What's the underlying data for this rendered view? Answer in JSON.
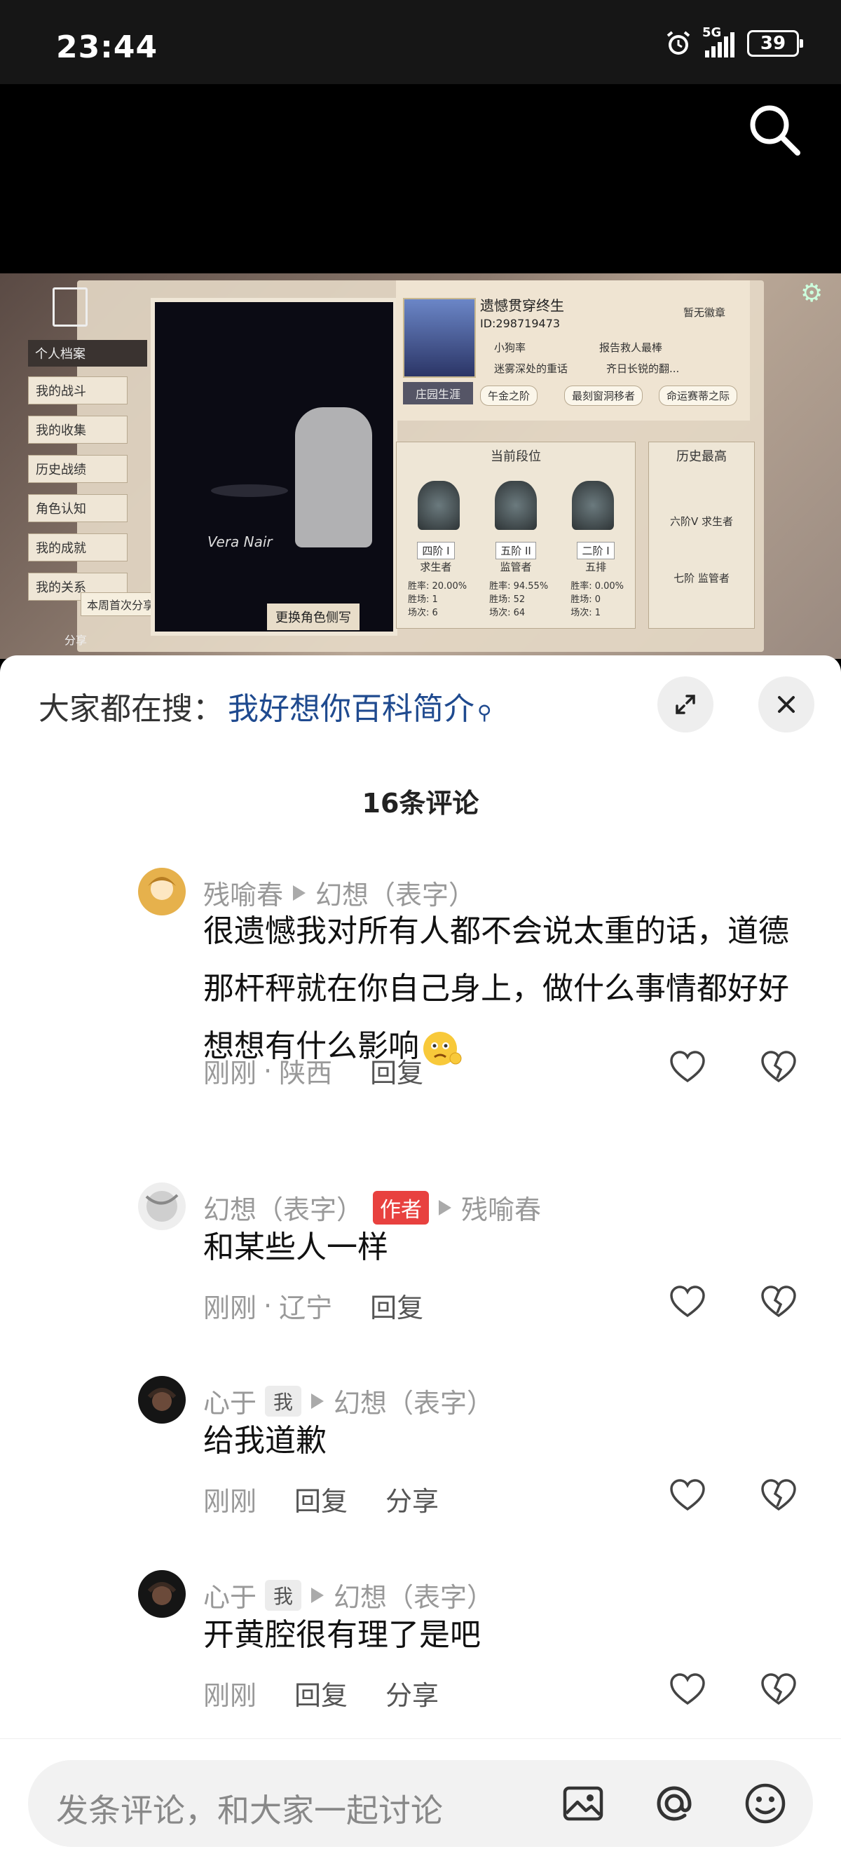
{
  "status_bar": {
    "time": "23:44",
    "network": "5G",
    "battery": "39"
  },
  "video": {
    "game_ui": {
      "menu_title": "个人档案",
      "menu_items": [
        "我的战斗",
        "我的收集",
        "历史战绩",
        "角色认知",
        "我的成就",
        "我的关系"
      ],
      "share_tag": "本周首次分享",
      "share_label": "分享",
      "scene_signature": "Vera Nair",
      "change_side_button": "更换角色侧写",
      "avatar_tag": "庄园生涯",
      "player_name": "遗憾贯穿终生",
      "player_id": "ID:298719473",
      "lines": [
        "小狗率",
        "报告救人最棒",
        "迷雾深处的重话",
        "齐日长锐的翻...",
        "午金之阶",
        "最刻窗洞移者",
        "命运赛蒂之际",
        "暂无徽章"
      ],
      "rank_title": "当前段位",
      "ranks": [
        {
          "level": "四阶 I",
          "role": "求生者",
          "stats": [
            "胜率: 20.00%",
            "胜场: 1",
            "场次: 6"
          ]
        },
        {
          "level": "五阶 II",
          "role": "监管者",
          "stats": [
            "胜率: 94.55%",
            "胜场: 52",
            "场次: 64"
          ]
        },
        {
          "level": "二阶 I",
          "role": "五排",
          "stats": [
            "胜率: 0.00%",
            "胜场: 0",
            "场次: 1"
          ]
        }
      ],
      "history_title": "历史最高",
      "history": [
        "六阶V 求生者",
        "七阶 监管者"
      ]
    }
  },
  "sheet": {
    "search_prefix": "大家都在搜：",
    "search_term": "我好想你百科简介",
    "comment_count": "16条评论"
  },
  "comments": [
    {
      "author": "残喻春",
      "reply_to": "幻想（表字）",
      "text": "很遗憾我对所有人都不会说太重的话，道德那杆秤就在你自己身上，做什么事情都好好想想有什么影响",
      "time": "刚刚",
      "location": "陕西",
      "reply_label": "回复"
    },
    {
      "author": "幻想（表字）",
      "author_badge": "作者",
      "reply_to": "残喻春",
      "text": "和某些人一样",
      "time": "刚刚",
      "location": "辽宁",
      "reply_label": "回复"
    },
    {
      "author": "心于",
      "me_badge": "我",
      "reply_to": "幻想（表字）",
      "text": "给我道歉",
      "time": "刚刚",
      "reply_label": "回复",
      "share_label": "分享"
    },
    {
      "author": "心于",
      "me_badge": "我",
      "reply_to": "幻想（表字）",
      "text": "开黄腔很有理了是吧",
      "time": "刚刚",
      "reply_label": "回复",
      "share_label": "分享"
    }
  ],
  "input_bar": {
    "placeholder": "发条评论，和大家一起讨论"
  },
  "colors": {
    "search_term": "#1f4a8f",
    "author_badge": "#e8413f"
  }
}
